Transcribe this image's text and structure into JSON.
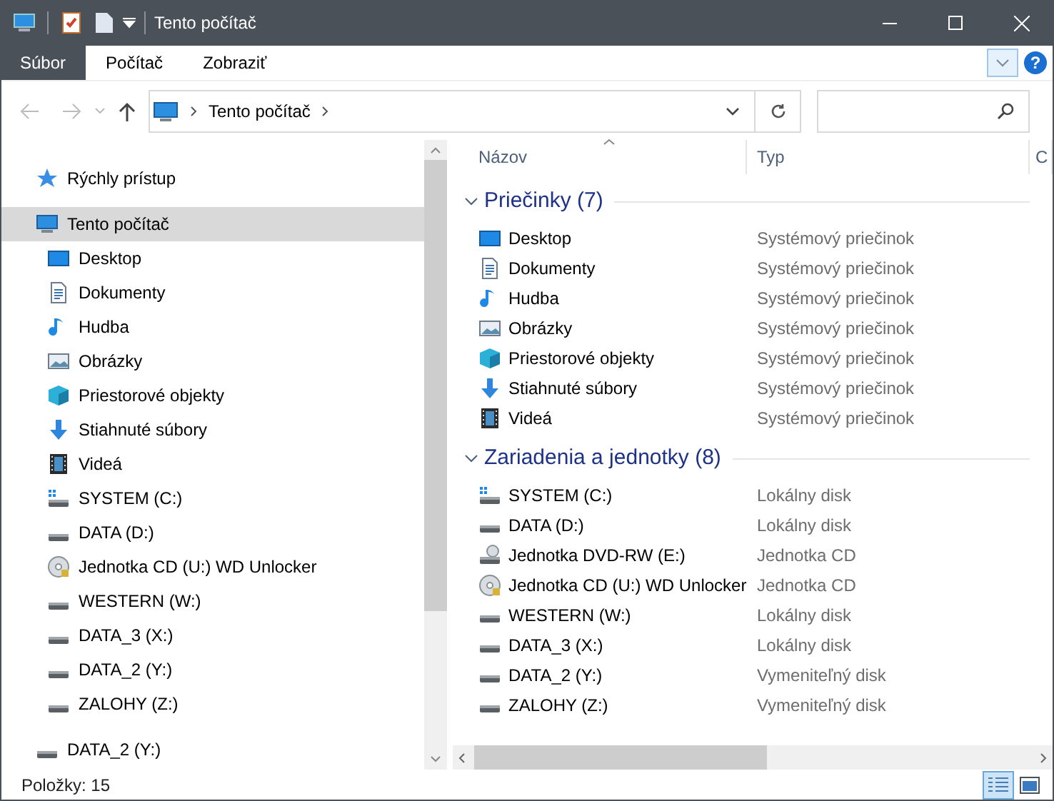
{
  "window": {
    "title": "Tento počítač"
  },
  "ribbon": {
    "tabs": [
      {
        "label": "Súbor",
        "kind": "file"
      },
      {
        "label": "Počítač",
        "kind": "tab"
      },
      {
        "label": "Zobraziť",
        "kind": "tab"
      }
    ],
    "help": "?"
  },
  "address_bar": {
    "path": [
      "Tento počítač"
    ]
  },
  "navigation": [
    {
      "label": "Rýchly prístup",
      "kind": "star",
      "selected": false
    },
    {
      "label": "Tento počítač",
      "kind": "computer",
      "selected": true,
      "children": [
        {
          "label": "Desktop",
          "kind": "desktop",
          "selected": false
        },
        {
          "label": "Dokumenty",
          "kind": "documents",
          "selected": false
        },
        {
          "label": "Hudba",
          "kind": "music",
          "selected": false
        },
        {
          "label": "Obrázky",
          "kind": "pictures",
          "selected": false
        },
        {
          "label": "Priestorové objekty",
          "kind": "cube",
          "selected": false
        },
        {
          "label": "Stiahnuté súbory",
          "kind": "downloads",
          "selected": false
        },
        {
          "label": "Videá",
          "kind": "videos",
          "selected": false
        },
        {
          "label": "SYSTEM (C:)",
          "kind": "system_drive",
          "selected": false
        },
        {
          "label": "DATA (D:)",
          "kind": "drive",
          "selected": false
        },
        {
          "label": "Jednotka CD (U:) WD Unlocker",
          "kind": "cd",
          "selected": false
        },
        {
          "label": "WESTERN (W:)",
          "kind": "drive",
          "selected": false
        },
        {
          "label": "DATA_3 (X:)",
          "kind": "drive",
          "selected": false
        },
        {
          "label": "DATA_2 (Y:)",
          "kind": "drive",
          "selected": false
        },
        {
          "label": "ZALOHY (Z:)",
          "kind": "drive",
          "selected": false
        }
      ]
    },
    {
      "label": "DATA_2 (Y:)",
      "kind": "drive",
      "selected": false
    }
  ],
  "columns": [
    "Názov",
    "Typ",
    "C"
  ],
  "groups": [
    {
      "title": "Priečinky (7)",
      "expanded": true,
      "items": [
        {
          "name": "Desktop",
          "type": "Systémový priečinok",
          "kind": "desktop"
        },
        {
          "name": "Dokumenty",
          "type": "Systémový priečinok",
          "kind": "documents"
        },
        {
          "name": "Hudba",
          "type": "Systémový priečinok",
          "kind": "music"
        },
        {
          "name": "Obrázky",
          "type": "Systémový priečinok",
          "kind": "pictures"
        },
        {
          "name": "Priestorové objekty",
          "type": "Systémový priečinok",
          "kind": "cube"
        },
        {
          "name": "Stiahnuté súbory",
          "type": "Systémový priečinok",
          "kind": "downloads"
        },
        {
          "name": "Videá",
          "type": "Systémový priečinok",
          "kind": "videos"
        }
      ]
    },
    {
      "title": "Zariadenia a jednotky (8)",
      "expanded": true,
      "items": [
        {
          "name": "SYSTEM (C:)",
          "type": "Lokálny disk",
          "kind": "system_drive"
        },
        {
          "name": "DATA (D:)",
          "type": "Lokálny disk",
          "kind": "drive"
        },
        {
          "name": "Jednotka DVD-RW (E:)",
          "type": "Jednotka CD",
          "kind": "dvd"
        },
        {
          "name": "Jednotka CD (U:) WD Unlocker",
          "type": "Jednotka CD",
          "kind": "cd"
        },
        {
          "name": "WESTERN (W:)",
          "type": "Lokálny disk",
          "kind": "drive"
        },
        {
          "name": "DATA_3 (X:)",
          "type": "Lokálny disk",
          "kind": "drive"
        },
        {
          "name": "DATA_2 (Y:)",
          "type": "Vymeniteľný disk",
          "kind": "drive"
        },
        {
          "name": "ZALOHY (Z:)",
          "type": "Vymeniteľný disk",
          "kind": "drive"
        }
      ]
    }
  ],
  "status_bar": {
    "text": "Položky: 15",
    "views": [
      {
        "kind": "details",
        "selected": true
      },
      {
        "kind": "large_icons",
        "selected": false
      }
    ]
  }
}
